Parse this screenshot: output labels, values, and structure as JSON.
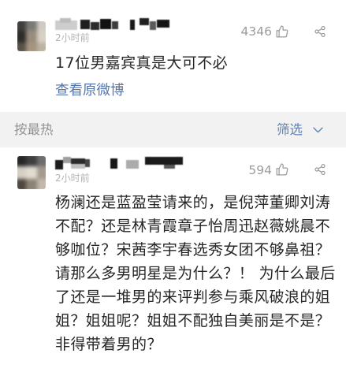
{
  "theme": {
    "text": "#262626",
    "muted": "#9b9b9b",
    "time": "#b3b3b3",
    "link": "#5176ae",
    "filter": "#6282b5",
    "sort": "#929292",
    "band": "#f2f2f2"
  },
  "top_comment": {
    "time": "2小时前",
    "like_count": "4346",
    "like_icon": "thumbs-up-icon",
    "share_icon": "share-icon",
    "text": "17位男嘉宾真是大可不必",
    "view_original_label": "查看原微博"
  },
  "sort_bar": {
    "sort_label": "按最热",
    "filter_label": "筛选",
    "filter_icon": "chevron-down-icon"
  },
  "reply": {
    "time": "2小时前",
    "like_count": "594",
    "like_icon": "thumbs-up-icon",
    "share_icon": "share-icon",
    "text_lines": [
      "杨澜还是蓝盈莹请来的，是倪萍董卿刘涛",
      "不配？还是林青霞章子怡周迅赵薇姚晨不",
      "够咖位？宋茜李宇春选秀女团不够鼻祖？",
      "请那么多男明星是为什么？！ 为什么最后",
      "了还是一堆男的来评判参与乘风破浪的姐",
      "姐？姐姐呢？姐姐不配独自美丽是不是？",
      "非得带着男的？"
    ]
  }
}
